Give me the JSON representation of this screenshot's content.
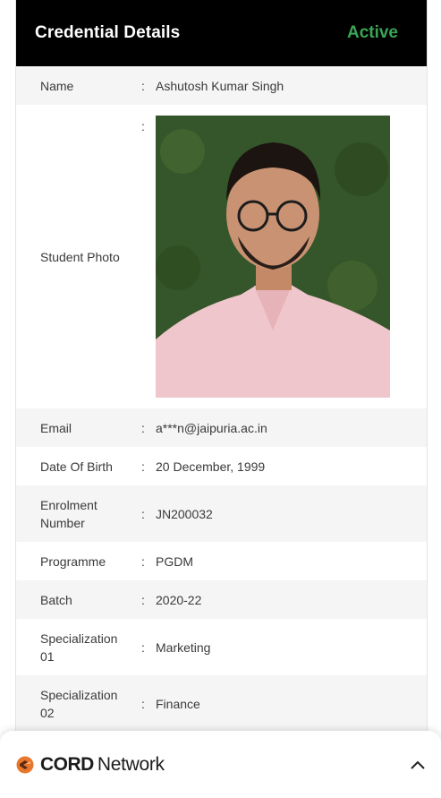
{
  "header": {
    "title": "Credential Details",
    "status": "Active"
  },
  "colors": {
    "status_active": "#3aa655",
    "header_bg": "#000000",
    "row_shade": "#f5f5f5",
    "brand_logo": "#e8772e"
  },
  "separator": ":",
  "fields": [
    {
      "label": "Name",
      "value": "Ashutosh Kumar Singh"
    },
    {
      "label": "Student Photo",
      "value": ""
    },
    {
      "label": "Email",
      "value": "a***n@jaipuria.ac.in"
    },
    {
      "label": "Date Of Birth",
      "value": "20 December, 1999"
    },
    {
      "label": "Enrolment Number",
      "value": "JN200032"
    },
    {
      "label": "Programme",
      "value": "PGDM"
    },
    {
      "label": "Batch",
      "value": "2020-22"
    },
    {
      "label": "Specialization 01",
      "value": "Marketing"
    },
    {
      "label": "Specialization 02",
      "value": "Finance"
    }
  ],
  "footer": {
    "brand_bold": "CORD",
    "brand_light": "Network",
    "logo_icon": "cord-network-logo-icon",
    "toggle_icon": "chevron-up-icon"
  }
}
